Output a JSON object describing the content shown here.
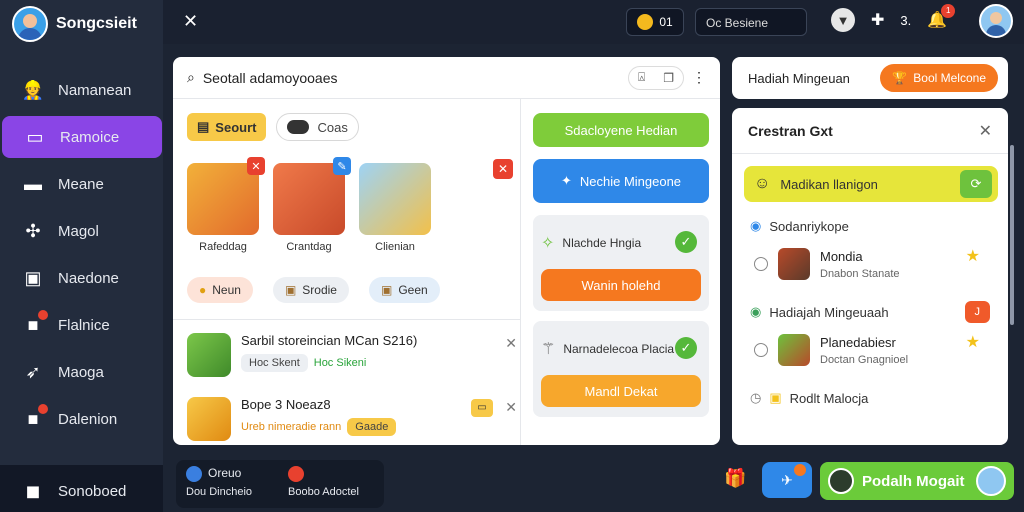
{
  "brand": {
    "name": "Songcsieit"
  },
  "sidebar": {
    "items": [
      {
        "label": "Namanean",
        "icon": "worker-icon"
      },
      {
        "label": "Ramoice",
        "icon": "bag-icon",
        "active": true
      },
      {
        "label": "Meane",
        "icon": "folder-icon"
      },
      {
        "label": "Magol",
        "icon": "puzzle-icon"
      },
      {
        "label": "Naedone",
        "icon": "briefcase-icon"
      },
      {
        "label": "Flalnice",
        "icon": "gift-icon",
        "badge": true
      },
      {
        "label": "Maoga",
        "icon": "rocket-icon"
      },
      {
        "label": "Dalenion",
        "icon": "gift-icon",
        "badge": true
      }
    ],
    "bottom_label": "Sonoboed"
  },
  "topbar": {
    "coins": "01",
    "search_text": "Oc Besiene",
    "count": "3.",
    "bell_badge": "1"
  },
  "main": {
    "header_title": "Seotall adamoyooaes",
    "filter_chip": "Seourt",
    "filter_toggle": "Coas",
    "apps": [
      {
        "label": "Rafeddag"
      },
      {
        "label": "Crantdag"
      },
      {
        "label": "Clienian"
      }
    ],
    "tags": [
      "Neun",
      "Srodie",
      "Geen"
    ],
    "feed": [
      {
        "title": "Sarbil storeincian MCan S216)",
        "sub_pill": "Hoc Skent",
        "sub_highlight": "Hoc Sikeni"
      },
      {
        "title": "Bope 3 Noeaz8",
        "sub_highlight": "Ureb nimeradie rann",
        "sub_tag": "Gaade"
      }
    ],
    "right_buttons": {
      "green": "Sdacloyene Hedian",
      "blue": "Nechie Mingeone",
      "card1_text": "Nlachde Hngia",
      "card1_btn": "Wanin holehd",
      "card2_text": "Narnadelecoa Placia",
      "card2_btn": "Mandl Dekat"
    }
  },
  "promo": {
    "text": "Hadiah Mingeuan",
    "button": "Bool Melcone"
  },
  "sidepanel": {
    "title": "Crestran Gxt",
    "yellow_row": "Madikan llanigon",
    "section1": "Sodanriykope",
    "items1": [
      {
        "t1": "Mondia",
        "t2": "Dnabon Stanate"
      }
    ],
    "section2": "Hadiajah Mingeuaah",
    "section2_badge": "J",
    "items2": [
      {
        "t1": "Planedabiesr",
        "t2": "Doctan Gnagnioel"
      }
    ],
    "section3": "Rodlt Malocja"
  },
  "bottombar": {
    "item1_top": "Oreuo",
    "item1_bottom": "Dou Dincheio",
    "item2_top": "",
    "item2_bottom": "Boobo Adoctel"
  },
  "cta": {
    "label": "Podalh Mogait"
  },
  "colors": {
    "accent_purple": "#8a45e6",
    "accent_green": "#6bcb3a",
    "accent_orange": "#f5781f",
    "accent_blue": "#2f88e8"
  }
}
